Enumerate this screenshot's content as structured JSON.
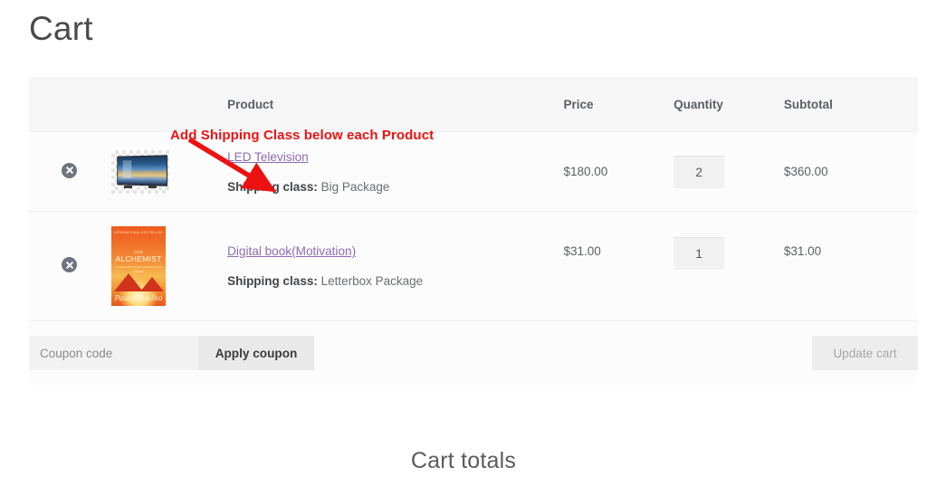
{
  "page": {
    "title": "Cart",
    "totals_heading": "Cart totals"
  },
  "annotation": {
    "text": "Add Shipping Class below each Product",
    "color": "#ee1111",
    "arrow": "red-arrow-down-right"
  },
  "table": {
    "headers": {
      "remove": "",
      "thumbnail": "",
      "product": "Product",
      "price": "Price",
      "quantity": "Quantity",
      "subtotal": "Subtotal"
    },
    "rows": [
      {
        "remove_label": "×",
        "thumb": "led-television-thumbnail",
        "name": "LED Television",
        "shipping_label": "Shipping class:",
        "shipping_class": "Big Package",
        "price": "$180.00",
        "quantity": "2",
        "subtotal": "$360.00"
      },
      {
        "remove_label": "×",
        "thumb": "the-alchemist-book-thumbnail",
        "name": "Digital book(Motivation)",
        "shipping_label": "Shipping class:",
        "shipping_class": "Letterbox Package",
        "price": "$31.00",
        "quantity": "1",
        "subtotal": "$31.00"
      }
    ]
  },
  "book_cover": {
    "top_line": "INTERNATIONAL BESTSELLER",
    "the": "THE",
    "title": "ALCHEMIST",
    "subtitle": "A FABLE ABOUT FOLLOWING YOUR DREAM",
    "author": "Paulo Coelho"
  },
  "actions": {
    "coupon_placeholder": "Coupon code",
    "coupon_value": "",
    "apply_label": "Apply coupon",
    "update_label": "Update cart"
  },
  "colors": {
    "link": "#8d6bb3",
    "header_bg": "#f6f6f6",
    "row_bg": "#fcfcfc",
    "annotation": "#ee1111",
    "remove_circle": "#6d7580"
  }
}
